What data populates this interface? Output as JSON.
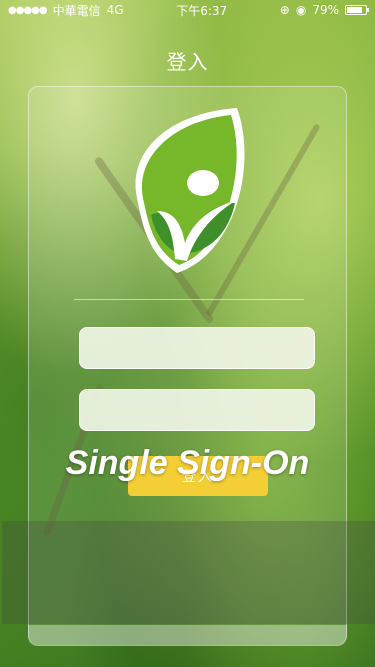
{
  "status_bar": {
    "carrier": "中華電信",
    "network": "4G",
    "time": "下午6:37",
    "battery": "79%"
  },
  "nav": {
    "title": "登入"
  },
  "login": {
    "username_placeholder": "",
    "password_placeholder": "",
    "submit_label": "登入"
  },
  "banner": {
    "text": "Single Sign-On"
  },
  "colors": {
    "button": "#f3cf35",
    "logo_green": "#76b82a",
    "logo_dark": "#3f8f2a"
  }
}
